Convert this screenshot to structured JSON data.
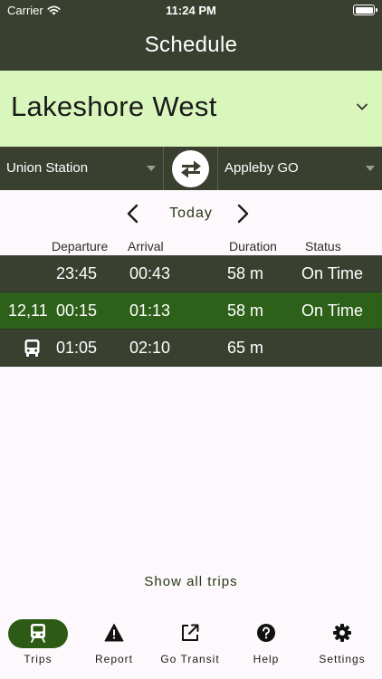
{
  "status_bar": {
    "carrier": "Carrier",
    "time": "11:24 PM"
  },
  "header": {
    "title": "Schedule"
  },
  "line": {
    "name": "Lakeshore West",
    "icon": "chevron-down-icon"
  },
  "route": {
    "from": "Union Station",
    "to": "Appleby GO",
    "swap_icon": "swap-arrows-icon"
  },
  "day_nav": {
    "label": "Today",
    "prev_icon": "chevron-left-icon",
    "next_icon": "chevron-right-icon"
  },
  "columns": {
    "departure": "Departure",
    "arrival": "Arrival",
    "duration": "Duration",
    "status": "Status"
  },
  "trips": [
    {
      "route_info": "",
      "departure": "23:45",
      "arrival": "00:43",
      "duration": "58 m",
      "status": "On Time"
    },
    {
      "route_info": "12,11",
      "departure": "00:15",
      "arrival": "01:13",
      "duration": "58 m",
      "status": "On Time"
    },
    {
      "route_info": "",
      "departure": "01:05",
      "arrival": "02:10",
      "duration": "65 m",
      "status": ""
    }
  ],
  "show_all": "Show all trips",
  "tabs": [
    {
      "label": "Trips",
      "icon": "train-icon",
      "active": true
    },
    {
      "label": "Report",
      "icon": "warning-icon",
      "active": false
    },
    {
      "label": "Go Transit",
      "icon": "external-link-icon",
      "active": false
    },
    {
      "label": "Help",
      "icon": "help-icon",
      "active": false
    },
    {
      "label": "Settings",
      "icon": "gear-icon",
      "active": false
    }
  ],
  "colors": {
    "header_bg": "#3a4030",
    "line_bg": "#d9f6bd",
    "highlight_row": "#2d6018",
    "accent": "#2d5a15"
  }
}
